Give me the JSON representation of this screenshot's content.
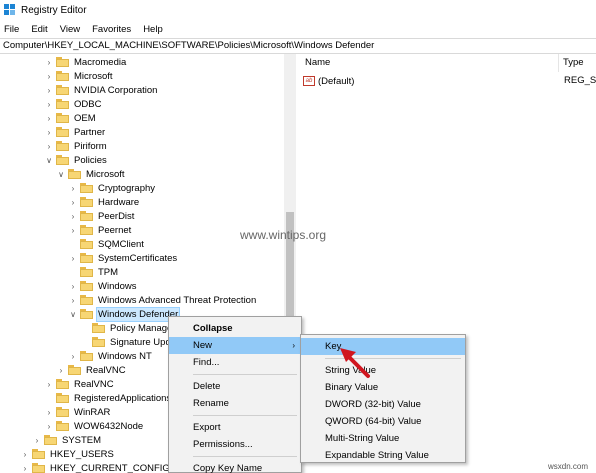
{
  "window": {
    "title": "Registry Editor"
  },
  "menu": [
    "File",
    "Edit",
    "View",
    "Favorites",
    "Help"
  ],
  "address": "Computer\\HKEY_LOCAL_MACHINE\\SOFTWARE\\Policies\\Microsoft\\Windows Defender",
  "tree": [
    {
      "label": "Macromedia",
      "expander": "right"
    },
    {
      "label": "Microsoft",
      "expander": "right"
    },
    {
      "label": "NVIDIA Corporation",
      "expander": "right"
    },
    {
      "label": "ODBC",
      "expander": "right"
    },
    {
      "label": "OEM",
      "expander": "right"
    },
    {
      "label": "Partner",
      "expander": "right"
    },
    {
      "label": "Piriform",
      "expander": "right"
    },
    {
      "label": "Policies",
      "expander": "down"
    },
    {
      "label": "Microsoft",
      "expander": "down"
    },
    {
      "label": "Cryptography",
      "expander": "right"
    },
    {
      "label": "Hardware",
      "expander": "right"
    },
    {
      "label": "PeerDist",
      "expander": "right"
    },
    {
      "label": "Peernet",
      "expander": "right"
    },
    {
      "label": "SQMClient",
      "expander": "none"
    },
    {
      "label": "SystemCertificates",
      "expander": "right"
    },
    {
      "label": "TPM",
      "expander": "none"
    },
    {
      "label": "Windows",
      "expander": "right"
    },
    {
      "label": "Windows Advanced Threat Protection",
      "expander": "right"
    },
    {
      "label": "Windows Defender",
      "expander": "down",
      "selected": true
    },
    {
      "label": "Policy Manage",
      "expander": "none"
    },
    {
      "label": "Signature Upda",
      "expander": "none"
    },
    {
      "label": "Windows NT",
      "expander": "right"
    },
    {
      "label": "RealVNC",
      "expander": "right"
    },
    {
      "label": "RealVNC",
      "expander": "right"
    },
    {
      "label": "RegisteredApplications",
      "expander": "none"
    },
    {
      "label": "WinRAR",
      "expander": "right"
    },
    {
      "label": "WOW6432Node",
      "expander": "right"
    },
    {
      "label": "SYSTEM",
      "expander": "right"
    },
    {
      "label": "HKEY_USERS",
      "expander": "right"
    },
    {
      "label": "HKEY_CURRENT_CONFIG",
      "expander": "right"
    }
  ],
  "columns": {
    "name": "Name",
    "type": "Type"
  },
  "values": [
    {
      "name": "(Default)",
      "type": "REG_SZ",
      "icon": "ab"
    }
  ],
  "watermark": "www.wintips.org",
  "context_menu": [
    {
      "label": "Collapse",
      "bold": true
    },
    {
      "label": "New",
      "submenu": true,
      "highlight": true
    },
    {
      "label": "Find..."
    },
    {
      "sep": true
    },
    {
      "label": "Delete"
    },
    {
      "label": "Rename"
    },
    {
      "sep": true
    },
    {
      "label": "Export"
    },
    {
      "label": "Permissions..."
    },
    {
      "sep": true
    },
    {
      "label": "Copy Key Name"
    }
  ],
  "submenu": [
    {
      "label": "Key",
      "highlight": true
    },
    {
      "sep": true
    },
    {
      "label": "String Value"
    },
    {
      "label": "Binary Value"
    },
    {
      "label": "DWORD (32-bit) Value"
    },
    {
      "label": "QWORD (64-bit) Value"
    },
    {
      "label": "Multi-String Value"
    },
    {
      "label": "Expandable String Value"
    }
  ],
  "site": "wsxdn.com",
  "colors": {
    "highlight": "#91c9f7",
    "selection": "#cce8ff",
    "folder": "#f7d674",
    "arrow": "#d0161f"
  }
}
